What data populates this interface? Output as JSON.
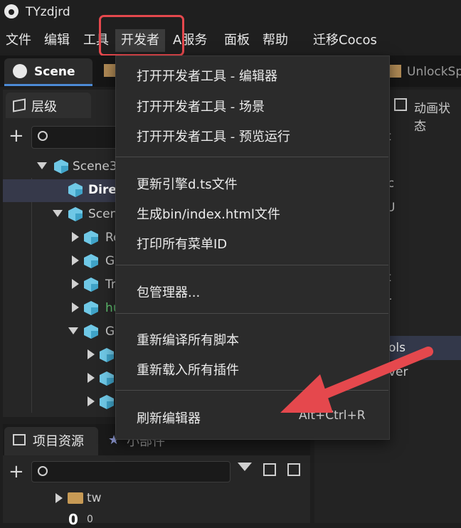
{
  "window": {
    "title": "TYzdjrd"
  },
  "menubar": {
    "items": [
      "文件",
      "编辑",
      "工具",
      "开发者",
      "A服务",
      "面板",
      "帮助",
      "迁移Cocos"
    ]
  },
  "tabs": {
    "scene": "Scene",
    "unlock": "UnlockSp"
  },
  "hierarchy": {
    "title": "层级",
    "rows": [
      "Scene3",
      "Direc",
      "Scen",
      "Re",
      "G",
      "Tr",
      "hu",
      "G"
    ]
  },
  "right_panel": {
    "tab": "动画状态",
    "fragments": [
      "t",
      "lc",
      "U",
      "J",
      "t",
      "r",
      "ols",
      "ver"
    ]
  },
  "assets": {
    "title": "项目资源",
    "widget_tab": "小部件",
    "folder": "tw",
    "item": "0",
    "item_sub": "0"
  },
  "dropdown": {
    "group1": [
      "打开开发者工具 - 编辑器",
      "打开开发者工具 - 场景",
      "打开开发者工具 - 预览运行"
    ],
    "group2": [
      "更新引擎d.ts文件",
      "生成bin/index.html文件",
      "打印所有菜单ID"
    ],
    "group3": [
      "包管理器..."
    ],
    "group4": [
      "重新编译所有脚本",
      "重新载入所有插件"
    ],
    "group5": [
      "刷新编辑器"
    ],
    "shortcut": "Alt+Ctrl+R"
  },
  "colors": {
    "highlight": "#e5484d",
    "accent": "#4d8bd6",
    "cube": "#6fc8e6"
  }
}
